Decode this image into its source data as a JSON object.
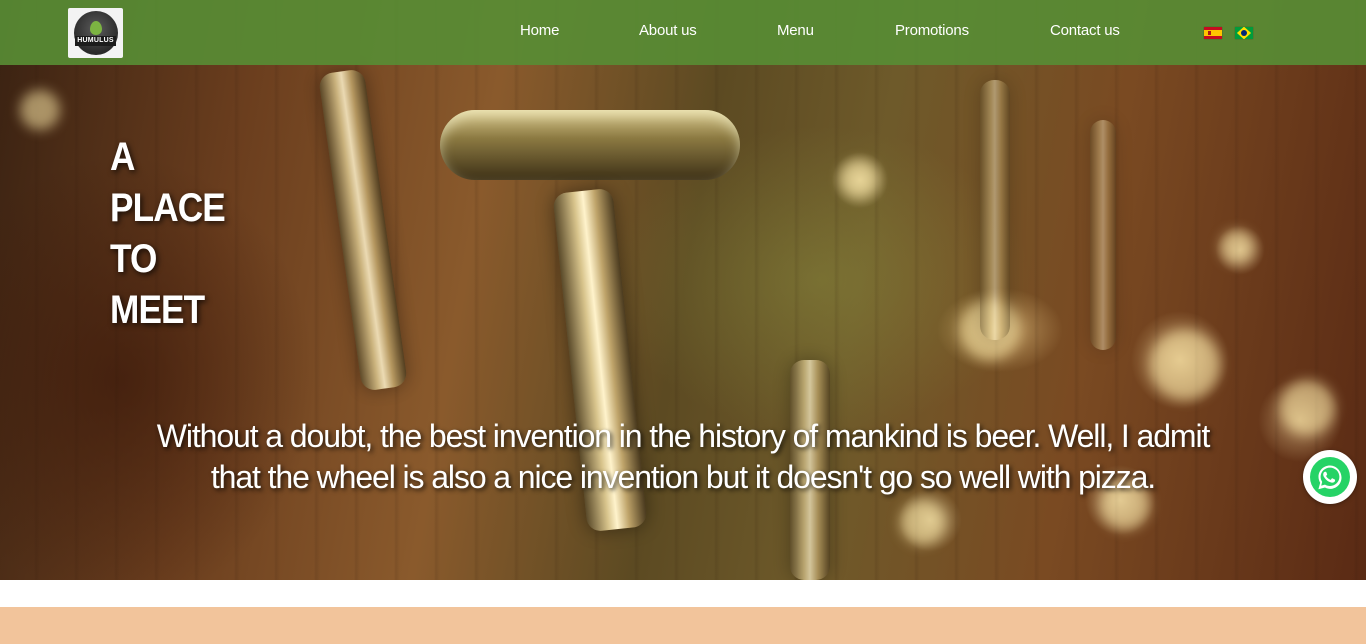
{
  "brand": {
    "logo_text": "HUMULUS",
    "logo_icon": "hop-icon"
  },
  "nav": {
    "items": [
      {
        "label": "Home"
      },
      {
        "label": "About us"
      },
      {
        "label": "Menu"
      },
      {
        "label": "Promotions"
      },
      {
        "label": "Contact us"
      }
    ],
    "languages": [
      {
        "icon": "spain-flag-icon"
      },
      {
        "icon": "brazil-flag-icon"
      }
    ]
  },
  "hero": {
    "headline_lines": [
      "A",
      "PLACE",
      "TO",
      "MEET"
    ],
    "quote_line1": "Without a doubt, the best invention in the history of mankind is beer. Well, I admit",
    "quote_line2": "that the wheel is also a nice invention but it doesn't go so well with pizza."
  },
  "whatsapp": {
    "icon": "whatsapp-icon"
  },
  "colors": {
    "nav_bg": "#588c34",
    "whatsapp_green": "#25d366",
    "peach_section": "#f2c49b"
  }
}
